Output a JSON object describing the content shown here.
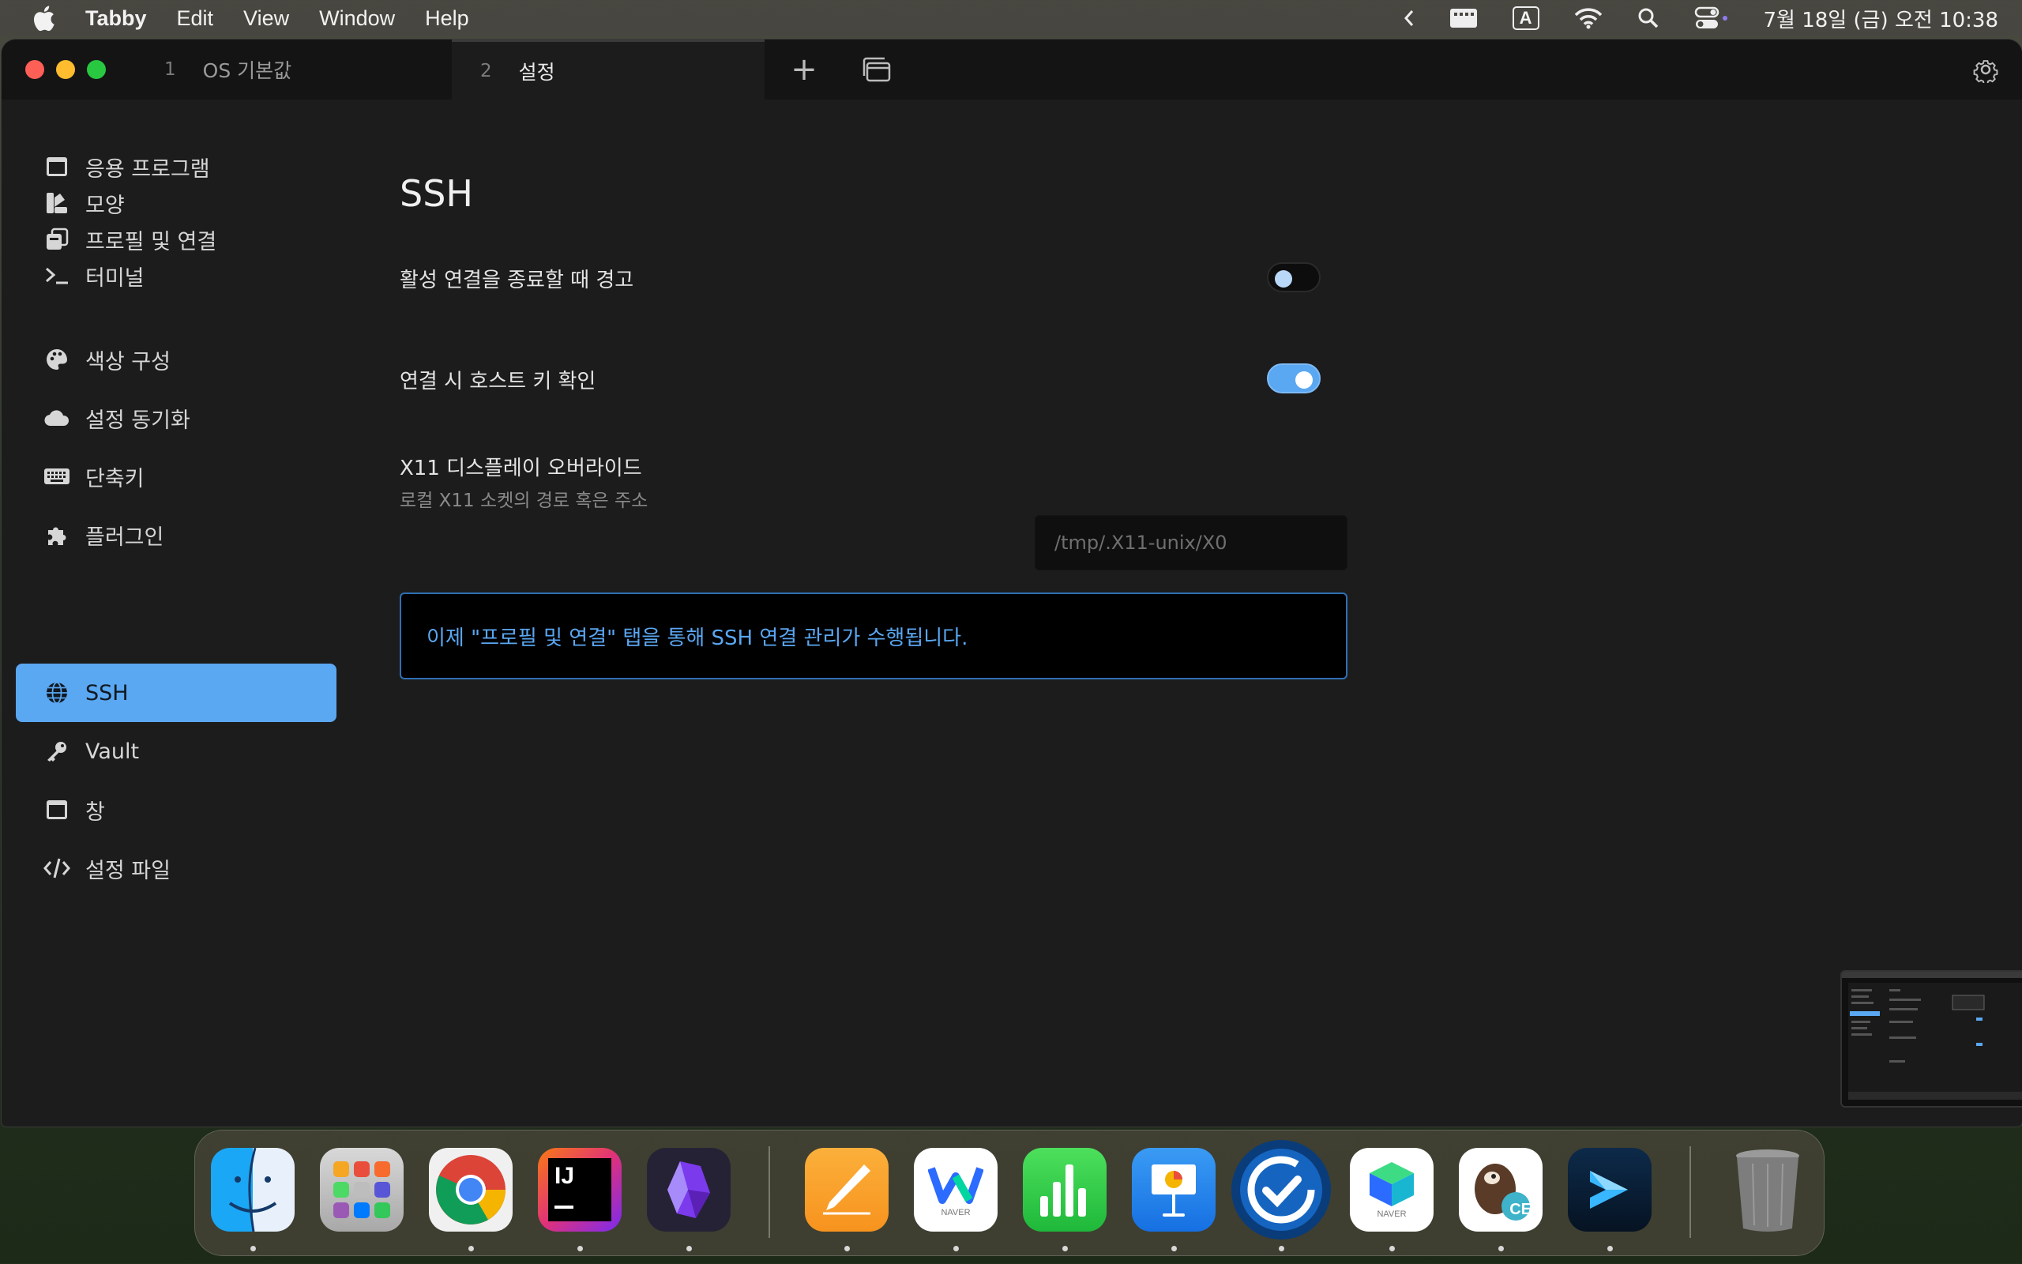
{
  "menubar": {
    "app_name": "Tabby",
    "items": [
      "Edit",
      "View",
      "Window",
      "Help"
    ],
    "input_indicator": "A",
    "clock": "7월 18일 (금) 오전 10:38"
  },
  "tabs": [
    {
      "number": "1",
      "label": "OS 기본값"
    },
    {
      "number": "2",
      "label": "설정"
    }
  ],
  "new_tab_symbol": "+",
  "sidebar": {
    "items": [
      {
        "label": "응용 프로그램",
        "icon": "window-icon"
      },
      {
        "label": "모양",
        "icon": "swatches-icon"
      },
      {
        "label": "프로필 및 연결",
        "icon": "profiles-icon"
      },
      {
        "label": "터미널",
        "icon": "terminal-icon"
      },
      {
        "label": "색상 구성",
        "icon": "palette-icon"
      },
      {
        "label": "설정 동기화",
        "icon": "cloud-icon"
      },
      {
        "label": "단축키",
        "icon": "keyboard-icon"
      },
      {
        "label": "플러그인",
        "icon": "puzzle-icon"
      },
      {
        "label": "SSH",
        "icon": "globe-icon",
        "active": true
      },
      {
        "label": "Vault",
        "icon": "key-icon"
      },
      {
        "label": "창",
        "icon": "window-icon"
      },
      {
        "label": "설정 파일",
        "icon": "code-icon"
      }
    ]
  },
  "main": {
    "title": "SSH",
    "warn_on_close": {
      "label": "활성 연결을 종료할 때 경고",
      "enabled": false
    },
    "verify_host_keys": {
      "label": "연결 시 호스트 키 확인",
      "enabled": true
    },
    "x11_display": {
      "label": "X11 디스플레이 오버라이드",
      "description": "로컬 X11 소켓의 경로 혹은 주소",
      "value": "",
      "placeholder": "/tmp/.X11-unix/X0"
    },
    "info": "이제 \"프로필 및 연결\" 탭을 통해 SSH 연결 관리가 수행됩니다."
  },
  "dock": {
    "apps": [
      "Finder",
      "Launchpad",
      "Chrome",
      "IntelliJ IDEA",
      "Obsidian",
      "Pages",
      "Naver Whale",
      "Numbers",
      "Keynote",
      "Sync",
      "Naver MYBOX",
      "DBeaver CE",
      "Tabby",
      "Trash"
    ],
    "whale_caption": "NAVER",
    "mybox_caption": "NAVER",
    "dbeaver_badge": "CE",
    "intellij_mark": "IJ"
  },
  "colors": {
    "accent": "#5aa7f2",
    "background": "#1c1c1c",
    "titlebar": "#141414"
  }
}
